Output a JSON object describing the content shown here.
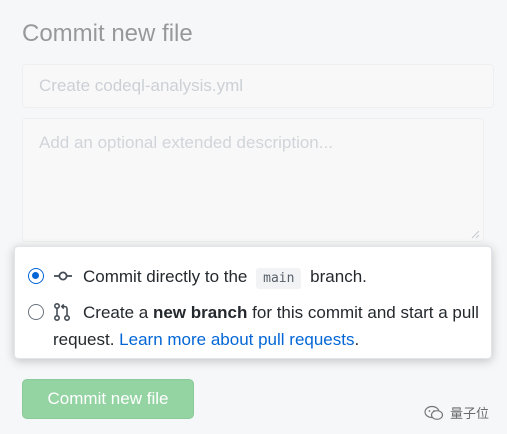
{
  "page_title": "Commit new file",
  "summary": {
    "placeholder": "Create codeql-analysis.yml"
  },
  "description": {
    "placeholder": "Add an optional extended description..."
  },
  "options": {
    "direct": {
      "prefix": "Commit directly to the",
      "branch": "main",
      "suffix": "branch.",
      "selected": true,
      "icon": "git-commit-icon"
    },
    "new_branch": {
      "prefix": "Create a",
      "bold": "new branch",
      "middle": "for this commit and start a pull request.",
      "link": "Learn more about pull requests",
      "end": ".",
      "selected": false,
      "icon": "git-pull-request-icon"
    }
  },
  "submit": {
    "label": "Commit new file"
  },
  "watermark": {
    "text": "量子位",
    "icon": "wechat-icon"
  },
  "colors": {
    "accent": "#0366d6",
    "button_bg": "#94d3a2",
    "text": "#24292e"
  }
}
